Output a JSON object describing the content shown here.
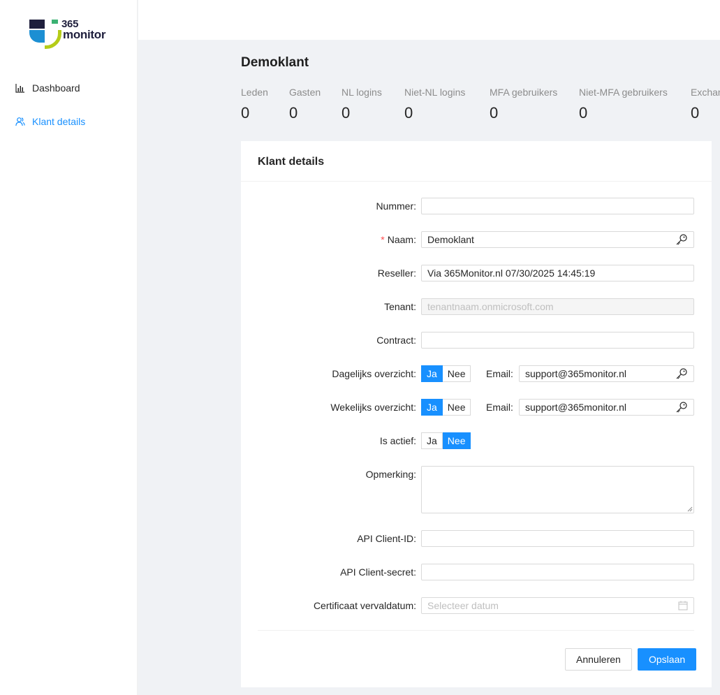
{
  "sidebar": {
    "logo": {
      "line1": "365",
      "line2": "monitor"
    },
    "items": [
      {
        "label": "Dashboard",
        "icon": "bar-chart-icon"
      },
      {
        "label": "Klant details",
        "icon": "users-icon"
      }
    ]
  },
  "page": {
    "title": "Demoklant"
  },
  "stats": [
    {
      "label": "Leden",
      "value": "0"
    },
    {
      "label": "Gasten",
      "value": "0"
    },
    {
      "label": "NL logins",
      "value": "0"
    },
    {
      "label": "Niet-NL logins",
      "value": "0"
    },
    {
      "label": "MFA gebruikers",
      "value": "0"
    },
    {
      "label": "Niet-MFA gebruikers",
      "value": "0"
    },
    {
      "label": "Exchan",
      "value": "0"
    }
  ],
  "form": {
    "title": "Klant details",
    "nummer": {
      "label": "Nummer",
      "value": ""
    },
    "naam": {
      "label": "Naam",
      "value": "Demoklant"
    },
    "reseller": {
      "label": "Reseller",
      "value": "Via 365Monitor.nl 07/30/2025 14:45:19"
    },
    "tenant": {
      "label": "Tenant",
      "placeholder": "tenantnaam.onmicrosoft.com"
    },
    "contract": {
      "label": "Contract",
      "value": ""
    },
    "dagelijks": {
      "label": "Dagelijks overzicht",
      "yes": "Ja",
      "no": "Nee",
      "selected": "Ja",
      "email_label": "Email",
      "email": "support@365monitor.nl"
    },
    "wekelijks": {
      "label": "Wekelijks overzicht",
      "yes": "Ja",
      "no": "Nee",
      "selected": "Ja",
      "email_label": "Email",
      "email": "support@365monitor.nl"
    },
    "actief": {
      "label": "Is actief",
      "yes": "Ja",
      "no": "Nee",
      "selected": "Nee"
    },
    "opmerking": {
      "label": "Opmerking",
      "value": ""
    },
    "client_id": {
      "label": "API Client-ID",
      "value": ""
    },
    "client_secret": {
      "label": "API Client-secret",
      "value": ""
    },
    "certificaat": {
      "label": "Certificaat vervaldatum",
      "placeholder": "Selecteer datum"
    },
    "cancel_label": "Annuleren",
    "save_label": "Opslaan"
  },
  "colors": {
    "primary": "#1890ff",
    "required": "#ff4d4f",
    "logo_dark": "#1f1f3d",
    "logo_blue": "#1c8fd3",
    "logo_lime": "#b5cc18",
    "logo_green": "#3bb273"
  }
}
